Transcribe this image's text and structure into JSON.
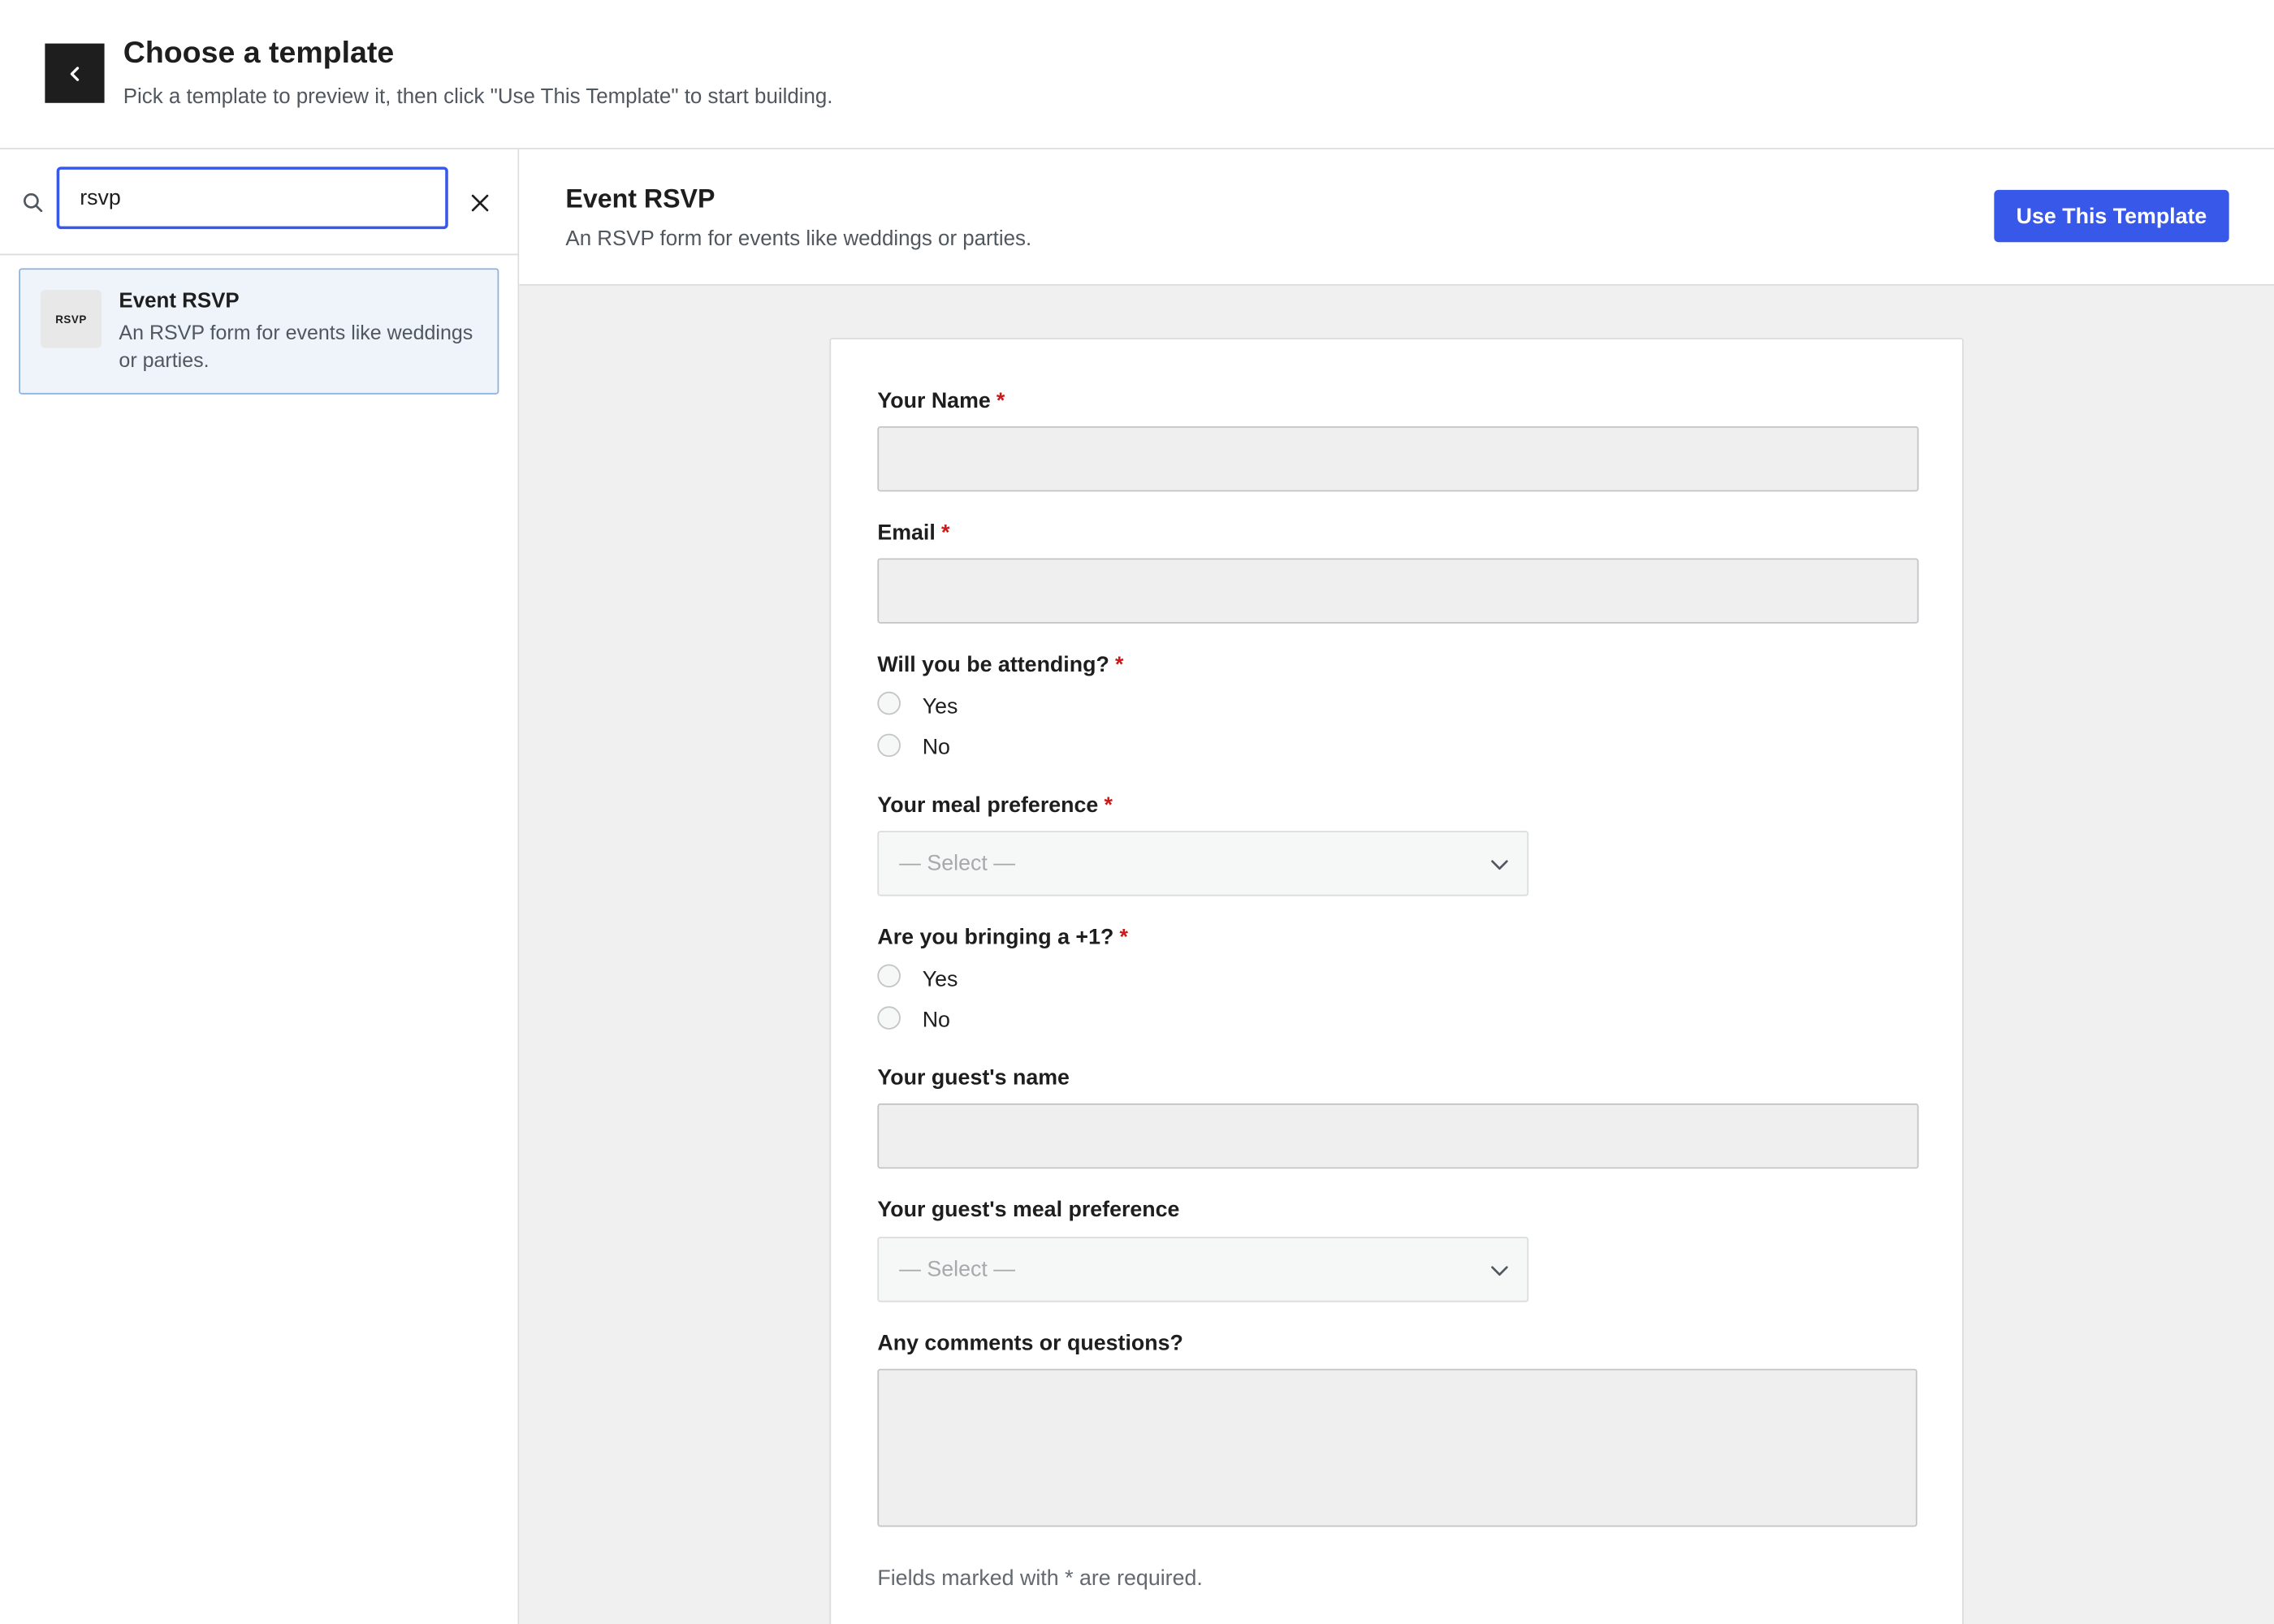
{
  "header": {
    "title": "Choose a template",
    "subtitle": "Pick a template to preview it, then click \"Use This Template\" to start building."
  },
  "search": {
    "value": "rsvp",
    "results": [
      {
        "thumb_text": "RSVP",
        "title": "Event RSVP",
        "description": "An RSVP form for events like weddings or parties."
      }
    ]
  },
  "preview": {
    "title": "Event RSVP",
    "description": "An RSVP form for events like weddings or parties.",
    "use_button": "Use This Template",
    "required_marker": "*",
    "fields": {
      "name_label": "Your Name",
      "email_label": "Email",
      "attending_label": "Will you be attending?",
      "attending_options": [
        "Yes",
        "No"
      ],
      "meal_label": "Your meal preference",
      "meal_placeholder": "— Select —",
      "plus_one_label": "Are you bringing a +1?",
      "plus_one_options": [
        "Yes",
        "No"
      ],
      "guest_name_label": "Your guest's name",
      "guest_meal_label": "Your guest's meal preference",
      "guest_meal_placeholder": "— Select —",
      "comments_label": "Any comments or questions?"
    },
    "footnote": "Fields marked with * are required."
  },
  "colors": {
    "accent": "#3858e9",
    "required": "#cc1818",
    "selected_bg": "#eef4fa"
  }
}
